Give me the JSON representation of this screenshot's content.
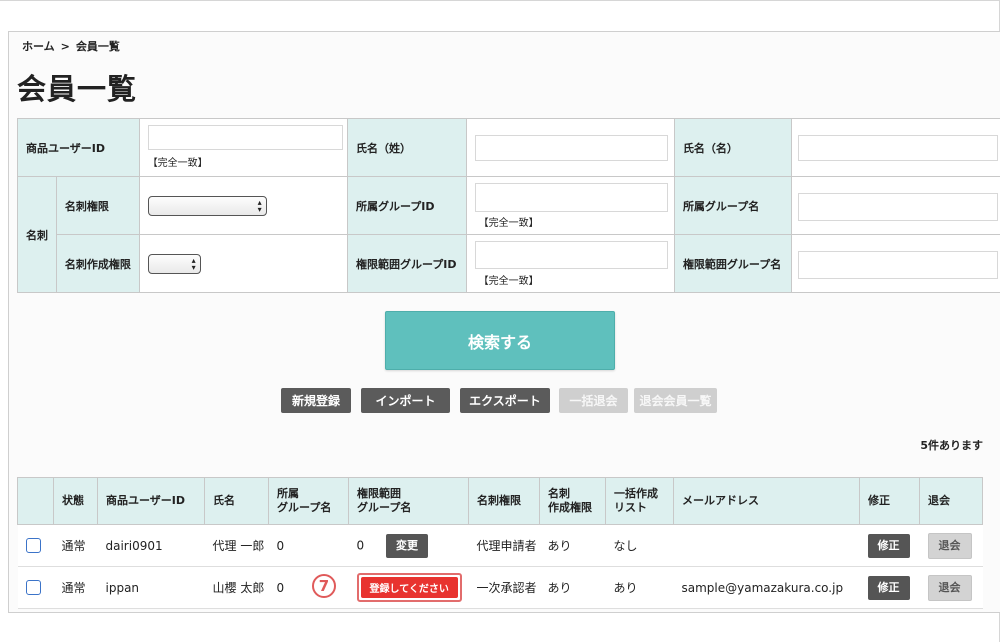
{
  "breadcrumb": {
    "home": "ホーム",
    "sep": ">",
    "current": "会員一覧"
  },
  "page_title": "会員一覧",
  "search": {
    "product_user_id": {
      "label": "商品ユーザーID",
      "value": "",
      "note": "【完全一致】"
    },
    "last_name": {
      "label": "氏名（姓）",
      "value": ""
    },
    "first_name": {
      "label": "氏名（名）",
      "value": ""
    },
    "meishi_group": "名刺",
    "meishi_auth": {
      "label": "名刺権限",
      "selected": ""
    },
    "meishi_create_auth": {
      "label": "名刺作成権限",
      "selected": ""
    },
    "group_id": {
      "label": "所属グループID",
      "value": "",
      "note": "【完全一致】"
    },
    "group_name": {
      "label": "所属グループ名",
      "value": ""
    },
    "scope_group_id": {
      "label": "権限範囲グループID",
      "value": "",
      "note": "【完全一致】"
    },
    "scope_group_name": {
      "label": "権限範囲グループ名",
      "value": ""
    },
    "submit_label": "検索する"
  },
  "actions": {
    "new": "新規登録",
    "import": "インポート",
    "export": "エクスポート",
    "bulk_withdraw": "一括退会",
    "withdrawn_list": "退会会員一覧"
  },
  "result_count": "5件あります",
  "table": {
    "headers": {
      "status": "状態",
      "user_id": "商品ユーザーID",
      "name": "氏名",
      "group_name_1": "所属",
      "group_name_2": "グループ名",
      "scope_group_1": "権限範囲",
      "scope_group_2": "グループ名",
      "meishi_auth": "名刺権限",
      "meishi_create_1": "名刺",
      "meishi_create_2": "作成権限",
      "bulk_list_1": "一括作成",
      "bulk_list_2": "リスト",
      "email": "メールアドレス",
      "edit": "修正",
      "withdraw": "退会"
    },
    "rows": [
      {
        "status": "通常",
        "user_id": "dairi0901",
        "name": "代理 一郎",
        "group": "0",
        "scope_group": "0",
        "scope_button": "変更",
        "meishi_auth": "代理申請者",
        "meishi_create": "あり",
        "bulk_list": "なし",
        "email": "",
        "edit": "修正",
        "withdraw": "退会"
      },
      {
        "status": "通常",
        "user_id": "ippan",
        "name": "山櫻 太郎",
        "group": "0",
        "scope_button": "登録してください",
        "meishi_auth": "一次承認者",
        "meishi_create": "あり",
        "bulk_list": "あり",
        "email": "sample@yamazakura.co.jp",
        "edit": "修正",
        "withdraw": "退会"
      }
    ]
  },
  "step_badge": "7",
  "colors": {
    "label_bg": "#ddf0ef",
    "search_button": "#5fc0bd",
    "dark_button": "#5b5b5b",
    "disabled_button": "#cfcfcf",
    "register_button": "#e8332f",
    "badge": "#e05a5a"
  }
}
